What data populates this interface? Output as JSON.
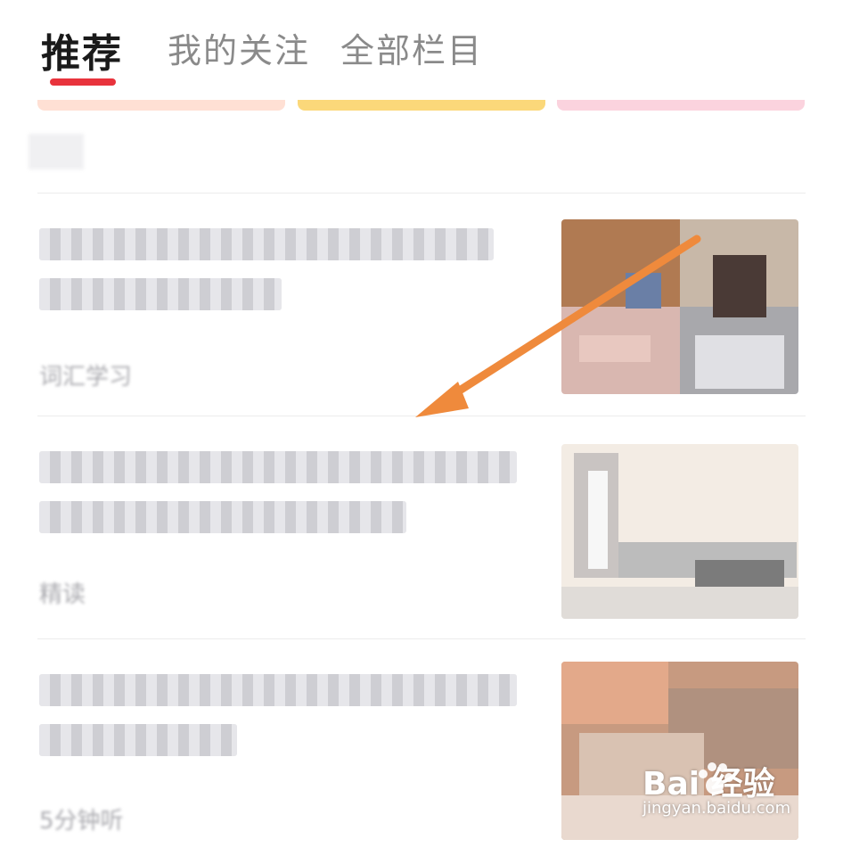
{
  "tabs": [
    {
      "label": "推荐",
      "active": true
    },
    {
      "label": "我的关注",
      "active": false
    },
    {
      "label": "全部栏目",
      "active": false
    }
  ],
  "colors": {
    "accent": "#e8333c",
    "arrow": "#ef8a3c",
    "pill_1": "#ffe0d4",
    "pill_2": "#fbd87a",
    "pill_3": "#fbd3de"
  },
  "articles": [
    {
      "meta": "词汇学习",
      "thumb_colors": [
        "#b07a52",
        "#e0b796",
        "#6a7fa6",
        "#d9b7b0"
      ]
    },
    {
      "meta": "精读",
      "thumb_colors": [
        "#f3ece4",
        "#c9c4c2",
        "#7b7b7b",
        "#e9e4de"
      ]
    },
    {
      "meta": "5分钟听",
      "thumb_colors": [
        "#e3a98a",
        "#c79a80",
        "#b0917f",
        "#e9d9cf"
      ]
    }
  ],
  "watermark": {
    "logo": "Bai 经验",
    "url": "jingyan.baidu.com"
  }
}
